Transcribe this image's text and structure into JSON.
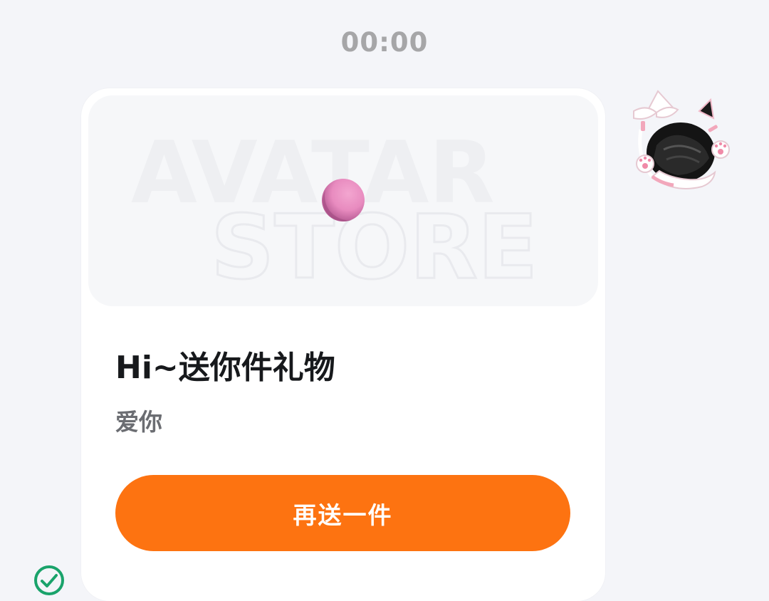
{
  "conversation": {
    "timestamp": "00:00"
  },
  "gift_card": {
    "banner_line_1": "AVATAR",
    "banner_line_2": "STORE",
    "title": "Hi~送你件礼物",
    "message": "爱你",
    "send_again_label": "再送一件"
  },
  "sender": {
    "avatar_icon": "cat-ear-avatar-icon"
  },
  "status": {
    "icon": "check-circle-icon",
    "color": "#1aa36b"
  },
  "colors": {
    "accent": "#fd7311",
    "background": "#f4f5f9",
    "card": "#ffffff",
    "orb": "#e88bbf"
  }
}
